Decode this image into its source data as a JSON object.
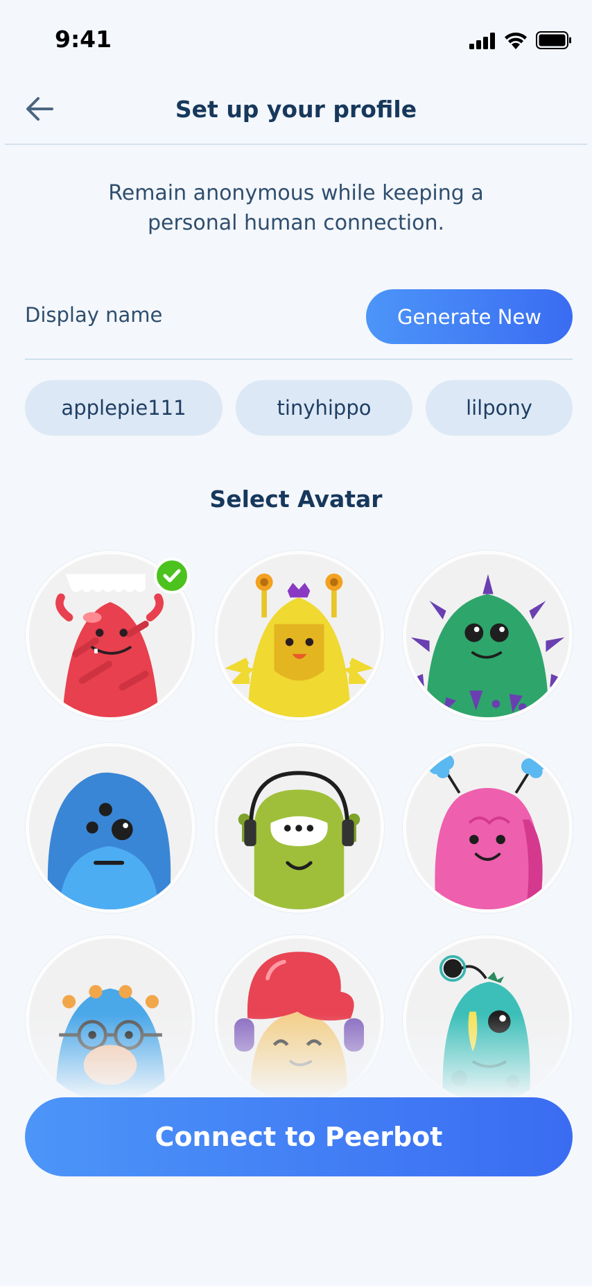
{
  "status_bar": {
    "time": "9:41"
  },
  "header": {
    "title": "Set up your profile"
  },
  "intro": {
    "line1": "Remain anonymous while keeping a",
    "line2": "personal human connection."
  },
  "display_name": {
    "label": "Display name",
    "generate_button": "Generate New",
    "suggestions": [
      "applepie111",
      "tinyhippo",
      "lilpony"
    ]
  },
  "avatar_section": {
    "title": "Select Avatar",
    "selected_index": 0,
    "avatars": [
      "red-monster-avatar",
      "yellow-monster-avatar",
      "green-spiky-monster-avatar",
      "blue-furry-monster-avatar",
      "green-headphones-monster-avatar",
      "pink-fluffy-monster-avatar",
      "blue-glasses-monster-avatar",
      "red-hair-headphones-avatar",
      "teal-antenna-monster-avatar"
    ]
  },
  "primary_action": {
    "label": "Connect to Peerbot"
  },
  "colors": {
    "accent_start": "#4c95f8",
    "accent_end": "#3a6cf2",
    "heading": "#17385c",
    "chip_bg": "#dce8f5",
    "check": "#4cc21e"
  }
}
